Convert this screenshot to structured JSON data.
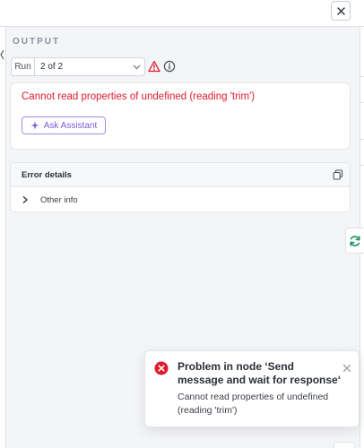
{
  "panel": {
    "section_title": "OUTPUT",
    "run_label": "Run",
    "run_value": "2 of 2"
  },
  "error": {
    "message": "Cannot read properties of undefined (reading 'trim')",
    "assistant_button_label": "Ask Assistant",
    "details_title": "Error details",
    "details_rows": [
      {
        "label": "Other info"
      }
    ]
  },
  "toast": {
    "title": "Problem in node ‘Send message and wait for response‘",
    "body": "Cannot read properties of undefined (reading 'trim')"
  },
  "colors": {
    "error_red": "#e0192b",
    "assistant_purple": "#7a5bd6",
    "refresh_green": "#1a8f5a",
    "background": "#f4f5f7"
  },
  "icons": {
    "close": "close-icon",
    "chevron_down": "chevron-down-icon",
    "warning": "warning-icon",
    "info": "info-icon",
    "sparkle": "sparkle-icon",
    "copy": "copy-icon",
    "chevron_right": "chevron-right-icon",
    "refresh": "refresh-icon",
    "error_circle": "error-circle-icon"
  }
}
